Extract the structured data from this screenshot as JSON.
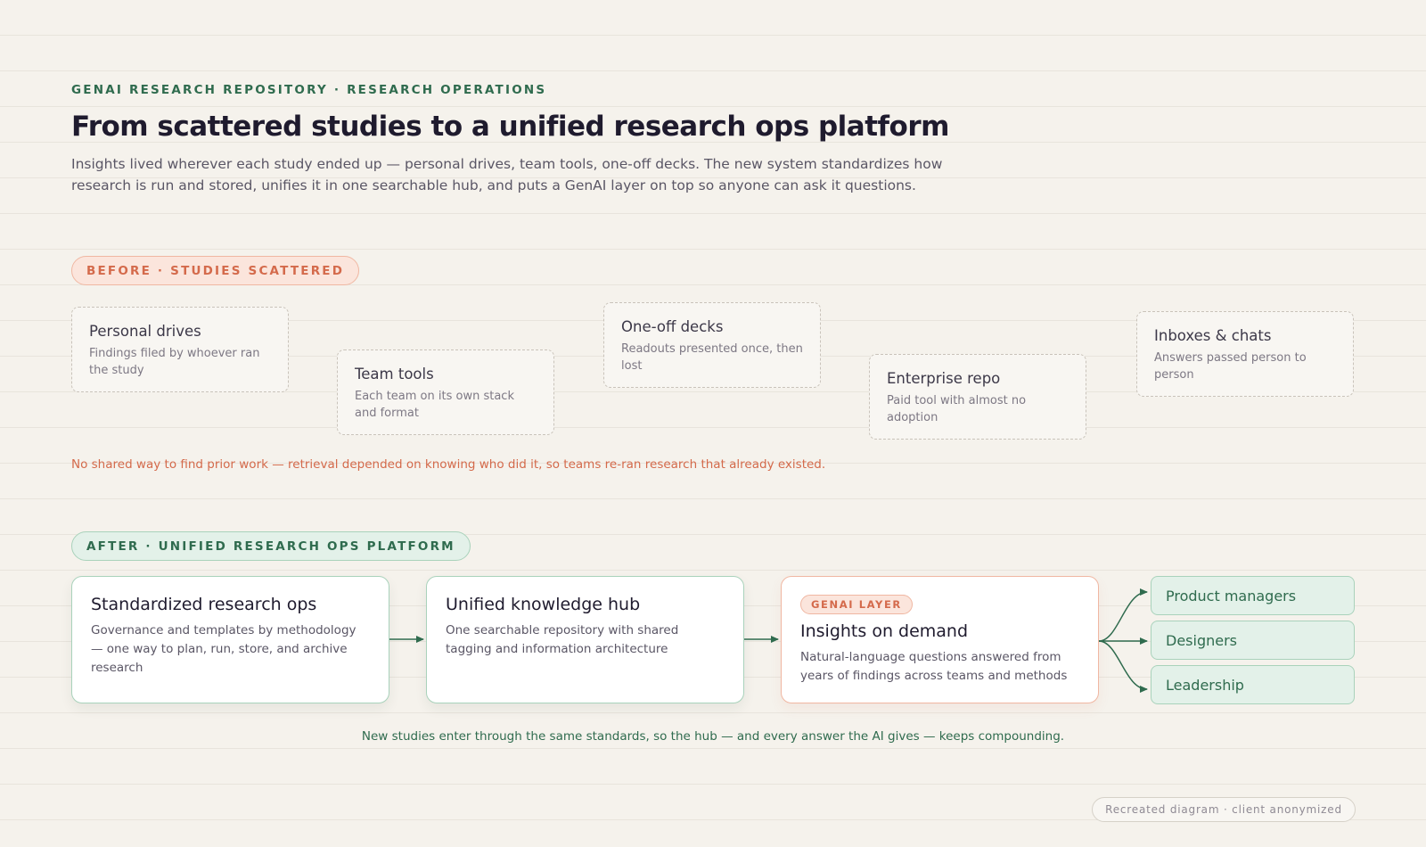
{
  "header": {
    "eyebrow": "GENAI RESEARCH REPOSITORY · RESEARCH OPERATIONS",
    "title": "From scattered studies to a unified research ops platform",
    "subtitle": "Insights lived wherever each study ended up — personal drives, team tools, one-off decks. The new system standardizes how research is run and stored, unifies it in one searchable hub, and puts a GenAI layer on top so anyone can ask it questions."
  },
  "before": {
    "label": "BEFORE · STUDIES SCATTERED",
    "sources": [
      {
        "title": "Personal drives",
        "desc": "Findings filed by whoever ran the study"
      },
      {
        "title": "Team tools",
        "desc": "Each team on its own stack and format"
      },
      {
        "title": "One-off decks",
        "desc": "Readouts presented once, then lost"
      },
      {
        "title": "Enterprise repo",
        "desc": "Paid tool with almost no adoption"
      },
      {
        "title": "Inboxes & chats",
        "desc": "Answers passed person to person"
      }
    ],
    "problem": "No shared way to find prior work — retrieval depended on knowing who did it, so teams re-ran research that already existed."
  },
  "after": {
    "label": "AFTER · UNIFIED RESEARCH OPS PLATFORM",
    "steps": [
      {
        "title": "Standardized research ops",
        "desc": "Governance and templates by methodology — one way to plan, run, store, and archive research"
      },
      {
        "title": "Unified knowledge hub",
        "desc": "One searchable repository with shared tagging and information architecture"
      },
      {
        "tag": "GENAI LAYER",
        "title": "Insights on demand",
        "desc": "Natural-language questions answered from years of findings across teams and methods"
      }
    ],
    "audiences": [
      "Product managers",
      "Designers",
      "Leadership"
    ],
    "footnote": "New studies enter through the same standards, so the hub — and every answer the AI gives — keeps compounding."
  },
  "credit": "Recreated diagram · client anonymized",
  "colors": {
    "accent_green": "#2f6b4e",
    "accent_coral": "#d46a4b",
    "background": "#f5f2ec"
  }
}
